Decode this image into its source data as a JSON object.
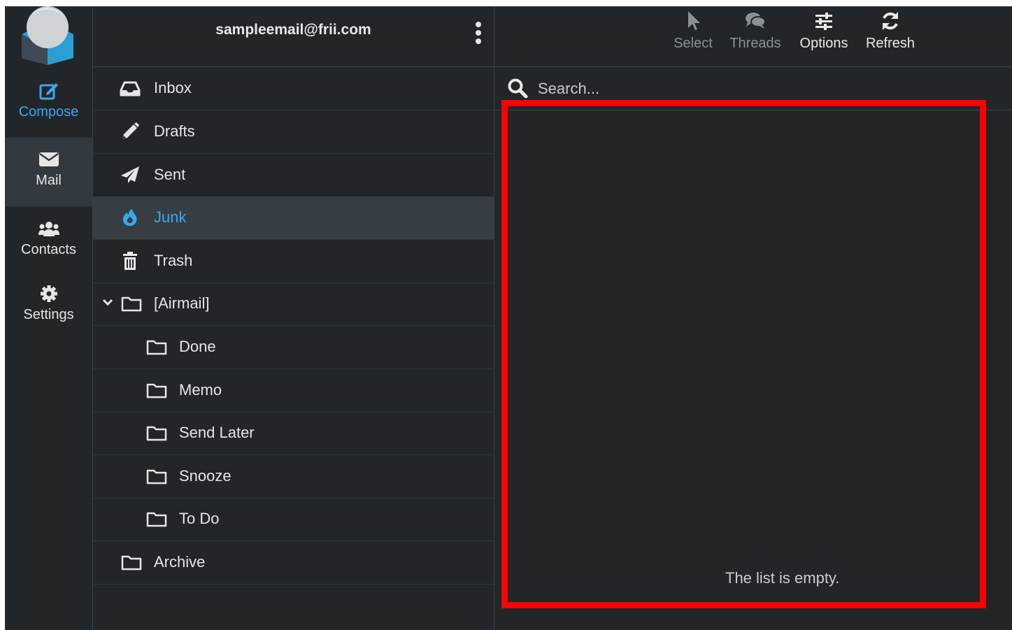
{
  "rail": {
    "items": [
      {
        "label": "Compose",
        "icon": "compose-icon"
      },
      {
        "label": "Mail",
        "icon": "envelope-icon"
      },
      {
        "label": "Contacts",
        "icon": "users-icon"
      },
      {
        "label": "Settings",
        "icon": "gear-icon"
      }
    ]
  },
  "account": {
    "email": "sampleemail@frii.com"
  },
  "folders": [
    {
      "label": "Inbox",
      "icon": "inbox-icon"
    },
    {
      "label": "Drafts",
      "icon": "pencil-icon"
    },
    {
      "label": "Sent",
      "icon": "paper-plane-icon"
    },
    {
      "label": "Junk",
      "icon": "fire-icon",
      "active": true
    },
    {
      "label": "Trash",
      "icon": "trash-icon"
    },
    {
      "label": "[Airmail]",
      "icon": "folder-icon",
      "expanded": true
    },
    {
      "label": "Done",
      "icon": "folder-icon"
    },
    {
      "label": "Memo",
      "icon": "folder-icon"
    },
    {
      "label": "Send Later",
      "icon": "folder-icon"
    },
    {
      "label": "Snooze",
      "icon": "folder-icon"
    },
    {
      "label": "To Do",
      "icon": "folder-icon"
    },
    {
      "label": "Archive",
      "icon": "folder-icon"
    }
  ],
  "toolbar": {
    "select": "Select",
    "threads": "Threads",
    "options": "Options",
    "refresh": "Refresh"
  },
  "search": {
    "placeholder": "Search..."
  },
  "list": {
    "empty_text": "The list is empty."
  },
  "colors": {
    "accent": "#3aa8f0",
    "background": "#222629",
    "highlight": "#ff0000"
  }
}
